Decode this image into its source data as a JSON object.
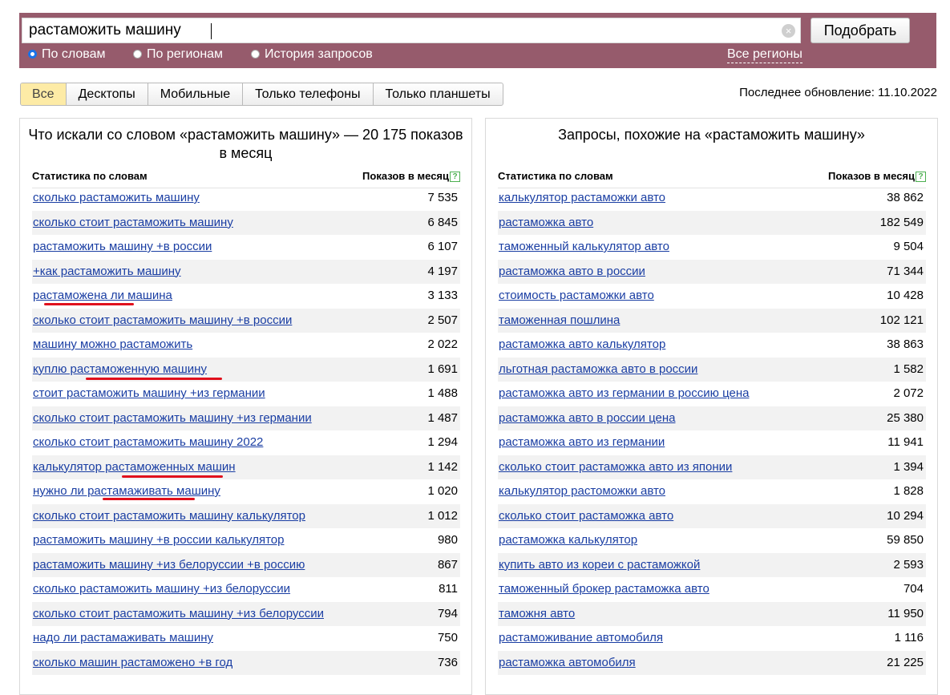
{
  "search": {
    "query": "растаможить машину",
    "submit_label": "Подобрать",
    "clear_symbol": "×",
    "modes": [
      {
        "label": "По словам",
        "selected": true
      },
      {
        "label": "По регионам",
        "selected": false
      },
      {
        "label": "История запросов",
        "selected": false
      }
    ],
    "regions_link": "Все регионы"
  },
  "tabs": [
    {
      "label": "Все",
      "active": true
    },
    {
      "label": "Десктопы",
      "active": false
    },
    {
      "label": "Мобильные",
      "active": false
    },
    {
      "label": "Только телефоны",
      "active": false
    },
    {
      "label": "Только планшеты",
      "active": false
    }
  ],
  "last_update": "Последнее обновление: 11.10.2022",
  "left_panel": {
    "title": "Что искали со словом «растаможить машину» — 20 175 показов в месяц",
    "col_query": "Статистика по словам",
    "col_count": "Показов в месяц",
    "help_symbol": "?",
    "rows": [
      {
        "query": "сколько растаможить машину",
        "count": "7 535"
      },
      {
        "query": "сколько стоит растаможить машину",
        "count": "6 845"
      },
      {
        "query": "растаможить машину +в россии",
        "count": "6 107"
      },
      {
        "query": "+как растаможить машину",
        "count": "4 197"
      },
      {
        "query": "растаможена ли машина",
        "count": "3 133"
      },
      {
        "query": "сколько стоит растаможить машину +в россии",
        "count": "2 507"
      },
      {
        "query": "машину можно растаможить",
        "count": "2 022"
      },
      {
        "query": "куплю растаможенную машину",
        "count": "1 691"
      },
      {
        "query": "стоит растаможить машину +из германии",
        "count": "1 488"
      },
      {
        "query": "сколько стоит растаможить машину +из германии",
        "count": "1 487"
      },
      {
        "query": "сколько стоит растаможить машину 2022",
        "count": "1 294"
      },
      {
        "query": "калькулятор растаможенных машин",
        "count": "1 142"
      },
      {
        "query": "нужно ли растамаживать машину",
        "count": "1 020"
      },
      {
        "query": "сколько стоит растаможить машину калькулятор",
        "count": "1 012"
      },
      {
        "query": "растаможить машину +в россии калькулятор",
        "count": "980"
      },
      {
        "query": "растаможить машину +из белоруссии +в россию",
        "count": "867"
      },
      {
        "query": "сколько растаможить машину +из белоруссии",
        "count": "811"
      },
      {
        "query": "сколько стоит растаможить машину +из белоруссии",
        "count": "794"
      },
      {
        "query": "надо ли растамаживать машину",
        "count": "750"
      },
      {
        "query": "сколько машин растаможено +в год",
        "count": "736"
      }
    ]
  },
  "right_panel": {
    "title": "Запросы, похожие на «растаможить машину»",
    "col_query": "Статистика по словам",
    "col_count": "Показов в месяц",
    "help_symbol": "?",
    "rows": [
      {
        "query": "калькулятор растаможки авто",
        "count": "38 862"
      },
      {
        "query": "растаможка авто",
        "count": "182 549"
      },
      {
        "query": "таможенный калькулятор авто",
        "count": "9 504"
      },
      {
        "query": "растаможка авто в россии",
        "count": "71 344"
      },
      {
        "query": "стоимость растаможки авто",
        "count": "10 428"
      },
      {
        "query": "таможенная пошлина",
        "count": "102 121"
      },
      {
        "query": "растаможка авто калькулятор",
        "count": "38 863"
      },
      {
        "query": "льготная растаможка авто в россии",
        "count": "1 582"
      },
      {
        "query": "растаможка авто из германии в россию цена",
        "count": "2 072"
      },
      {
        "query": "растаможка авто в россии цена",
        "count": "25 380"
      },
      {
        "query": "растаможка авто из германии",
        "count": "11 941"
      },
      {
        "query": "сколько стоит растаможка авто из японии",
        "count": "1 394"
      },
      {
        "query": "калькулятор растоможки авто",
        "count": "1 828"
      },
      {
        "query": "сколько стоит растаможка авто",
        "count": "10 294"
      },
      {
        "query": "растаможка калькулятор",
        "count": "59 850"
      },
      {
        "query": "купить авто из кореи с растаможкой",
        "count": "2 593"
      },
      {
        "query": "таможенный брокер растаможка авто",
        "count": "704"
      },
      {
        "query": "таможня авто",
        "count": "11 950"
      },
      {
        "query": "растаможивание автомобиля",
        "count": "1 116"
      },
      {
        "query": "растаможка автомобиля",
        "count": "21 225"
      }
    ]
  },
  "colors": {
    "header_bg": "#965b6c",
    "link": "#1a3ea3",
    "active_tab": "#fdeba6",
    "annotation": "#e0101c"
  }
}
